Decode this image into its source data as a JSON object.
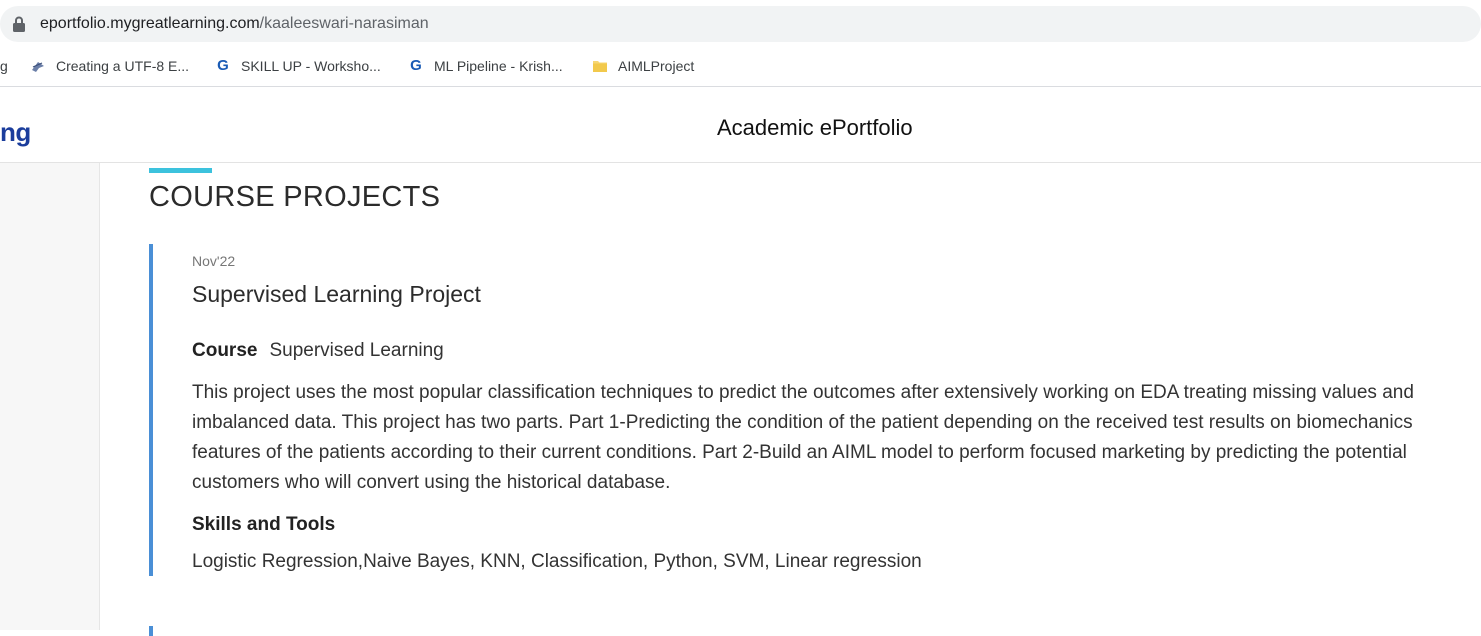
{
  "browser": {
    "url_domain": "eportfolio.mygreatlearning.com",
    "url_path": "/kaaleeswari-narasiman",
    "bookmarks": [
      {
        "label": "g",
        "icon": "blank-icon"
      },
      {
        "label": "Creating a UTF-8 E...",
        "icon": "site-favicon"
      },
      {
        "label": "SKILL UP - Worksho...",
        "icon": "g-icon"
      },
      {
        "label": "ML Pipeline - Krish...",
        "icon": "g-icon"
      },
      {
        "label": "AIMLProject",
        "icon": "folder-icon"
      }
    ]
  },
  "header": {
    "logo_fragment": "ng",
    "title": "Academic ePortfolio"
  },
  "section": {
    "title": "COURSE PROJECTS"
  },
  "project": {
    "date": "Nov'22",
    "title": "Supervised Learning Project",
    "course_label": "Course",
    "course_value": "Supervised Learning",
    "description": "This project uses the most popular classification techniques to predict the outcomes after extensively working on EDA treating missing values and imbalanced data. This project has two parts. Part 1-Predicting the condition of the patient depending on the received test results on biomechanics features of the patients according to their current conditions. Part 2-Build an AIML model to perform focused marketing by predicting the potential customers who will convert using the historical database.",
    "skills_heading": "Skills and Tools",
    "skills": "Logistic Regression,Naive Bayes, KNN, Classification, Python, SVM, Linear regression"
  },
  "colors": {
    "accent_cyan": "#3cc2dd",
    "card_border": "#4a8fd6",
    "logo_blue": "#1b3d9c"
  }
}
